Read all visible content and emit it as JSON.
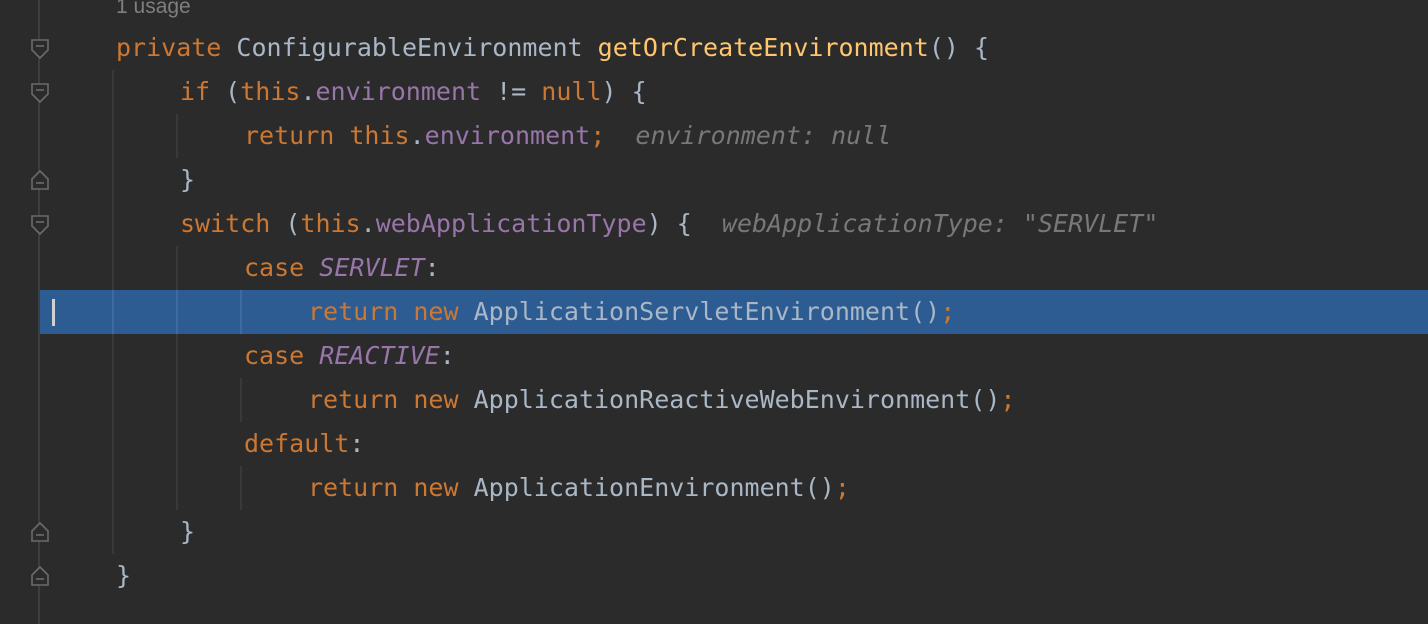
{
  "editor": {
    "usage_hint": "1 usage",
    "lines": {
      "l1": {
        "kw_private": "private",
        "type": "ConfigurableEnvironment",
        "method": "getOrCreateEnvironment",
        "rest": "() {"
      },
      "l2": {
        "kw_if": "if",
        "open": " (",
        "this": "this",
        "dot": ".",
        "field": "environment",
        "op": " != ",
        "null": "null",
        "close": ") {"
      },
      "l3": {
        "kw_return": "return",
        "this": "this",
        "dot": ".",
        "field": "environment",
        "semi": ";",
        "hint": "environment: null"
      },
      "l4": {
        "brace": "}"
      },
      "l5": {
        "kw_switch": "switch",
        "open": " (",
        "this": "this",
        "dot": ".",
        "field": "webApplicationType",
        "close": ") {",
        "hint": "webApplicationType: \"SERVLET\""
      },
      "l6": {
        "kw_case": "case",
        "const": "SERVLET",
        "colon": ":"
      },
      "l7": {
        "kw_return": "return",
        "kw_new": "new",
        "ctor": "ApplicationServletEnvironment",
        "parens": "()",
        "semi": ";"
      },
      "l8": {
        "kw_case": "case",
        "const": "REACTIVE",
        "colon": ":"
      },
      "l9": {
        "kw_return": "return",
        "kw_new": "new",
        "ctor": "ApplicationReactiveWebEnvironment",
        "parens": "()",
        "semi": ";"
      },
      "l10": {
        "kw_default": "default",
        "colon": ":"
      },
      "l11": {
        "kw_return": "return",
        "kw_new": "new",
        "ctor": "ApplicationEnvironment",
        "parens": "()",
        "semi": ";"
      },
      "l12": {
        "brace": "}"
      },
      "l13": {
        "brace": "}"
      }
    }
  },
  "colors": {
    "background": "#2b2b2b",
    "keyword": "#cc7832",
    "method": "#ffc66d",
    "field": "#9876aa",
    "text": "#a9b7c6",
    "hint": "#787878",
    "selection": "#2d5c93"
  }
}
